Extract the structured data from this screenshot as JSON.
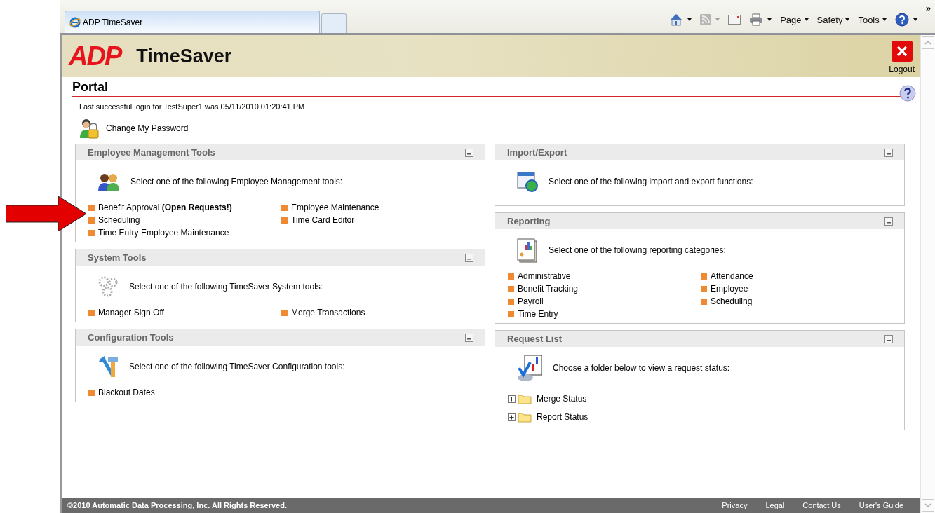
{
  "browser": {
    "tab_title": "ADP TimeSaver",
    "toolbar": [
      {
        "kind": "home"
      },
      {
        "kind": "feed"
      },
      {
        "kind": "mail"
      },
      {
        "kind": "print"
      },
      {
        "kind": "menu",
        "label": "Page"
      },
      {
        "kind": "menu",
        "label": "Safety"
      },
      {
        "kind": "menu",
        "label": "Tools"
      },
      {
        "kind": "help"
      },
      {
        "kind": "more",
        "label": "»"
      }
    ]
  },
  "header": {
    "logo": "ADP",
    "title": "TimeSaver",
    "logout": "Logout"
  },
  "page": {
    "title": "Portal",
    "last_login": "Last successful login for TestSuper1 was 05/11/2010 01:20:41 PM",
    "change_password": "Change My Password"
  },
  "columns": [
    [
      {
        "title": "Employee Management Tools",
        "kind": "people",
        "intro": "Select one of the following Employee Management tools:",
        "links": [
          "Benefit Approval **(Open Requests!)**",
          "Employee Maintenance",
          "Scheduling",
          "Time Card Editor",
          "Time Entry Employee Maintenance"
        ]
      },
      {
        "title": "System Tools",
        "kind": "gears",
        "intro": "Select one of the following TimeSaver System tools:",
        "links": [
          "Manager Sign Off",
          "Merge Transactions"
        ]
      },
      {
        "title": "Configuration Tools",
        "kind": "tools",
        "intro": "Select one of the following TimeSaver Configuration tools:",
        "links": [
          "Blackout Dates"
        ]
      }
    ],
    [
      {
        "title": "Import/Export",
        "kind": "window",
        "intro": "Select one of the following import and export functions:"
      },
      {
        "title": "Reporting",
        "kind": "report",
        "intro": "Select one of the following reporting categories:",
        "links": [
          "Administrative",
          "Attendance",
          "Benefit Tracking",
          "Employee",
          "Payroll",
          "Scheduling",
          "Time Entry"
        ]
      },
      {
        "title": "Request List",
        "kind": "request",
        "intro": "Choose a folder below to view a request status:",
        "tree": [
          {
            "label": "Merge Status",
            "expanded": false
          },
          {
            "label": "Report Status",
            "expanded": false
          }
        ]
      }
    ]
  ],
  "footer": {
    "copyright": "©2010 Automatic Data Processing, Inc. All Rights Reserved.",
    "links": [
      "Privacy",
      "Legal",
      "Contact Us",
      "User's Guide"
    ]
  }
}
